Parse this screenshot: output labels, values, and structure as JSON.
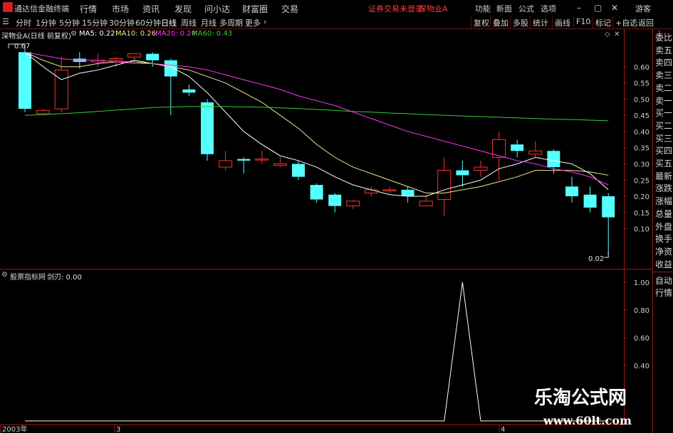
{
  "menubar": {
    "app_title": "通达信金融终端",
    "items": [
      "行情",
      "市场",
      "资讯",
      "发现",
      "问小达",
      "财富圈",
      "交易"
    ],
    "status_text": "证券交易未登录",
    "stock_name": "深物业A",
    "right_items": [
      "功能",
      "新面",
      "公式",
      "选项"
    ],
    "window_controls": [
      "–",
      "▢",
      "✕"
    ],
    "guest": "游客"
  },
  "toolbar": {
    "periods": [
      "分时",
      "1分钟",
      "5分钟",
      "15分钟",
      "30分钟",
      "60分钟",
      "日线",
      "周线",
      "月线",
      "多周期",
      "更多"
    ],
    "active_period": "日线",
    "right_buttons": [
      "复权",
      "叠加",
      "多股",
      "统计",
      "画线",
      "F10",
      "标记",
      "+自选",
      "返回"
    ]
  },
  "main_chart": {
    "title": "深物业A(日线 前复权)",
    "indicators": [
      {
        "label": "MA5: 0.22",
        "color": "#ffffff"
      },
      {
        "label": "MA10: 0.26",
        "color": "#f0e68c"
      },
      {
        "label": "MA20: 0.24",
        "color": "#ff33ff"
      },
      {
        "label": "MA60: 0.43",
        "color": "#33cc33"
      }
    ],
    "high_marker": "0.67",
    "low_marker": "0.02",
    "corner_label": "L",
    "price_ticks": [
      "0.60",
      "0.55",
      "0.50",
      "0.45",
      "0.40",
      "0.35",
      "0.30",
      "0.25",
      "0.20",
      "0.15",
      "0.10"
    ]
  },
  "sub_chart": {
    "title": "股票指标网",
    "indicator": "剑刃: 0.00",
    "ticks": [
      "1.00",
      "0.80",
      "0.60",
      "0.40"
    ]
  },
  "date_axis": [
    "2003年",
    "3",
    "4"
  ],
  "side_panel": {
    "items": [
      "委比",
      "卖五",
      "卖四",
      "卖三",
      "卖二",
      "卖一",
      "买一",
      "买二",
      "买三",
      "买四",
      "买五",
      "最新",
      "涨跌",
      "涨幅",
      "总量",
      "外盘",
      "换手",
      "净资",
      "收益"
    ],
    "bottom_items": [
      "自动",
      "行情"
    ]
  },
  "watermark": {
    "title": "乐淘公式网",
    "url": "www.60lt.com"
  },
  "colors": {
    "up": "#ff3232",
    "down": "#54ffff",
    "grid": "#a01818",
    "ma5": "#ffffff",
    "ma10": "#f0e68c",
    "ma20": "#ff33ff",
    "ma60": "#33cc33"
  },
  "chart_data": [
    {
      "type": "candlestick",
      "title": "深物业A(日线 前复权)",
      "ylim": [
        0.02,
        0.67
      ],
      "candles": [
        {
          "o": 0.645,
          "h": 0.67,
          "l": 0.46,
          "c": 0.47
        },
        {
          "o": 0.455,
          "h": 0.47,
          "l": 0.45,
          "c": 0.465
        },
        {
          "o": 0.47,
          "h": 0.63,
          "l": 0.46,
          "c": 0.59
        },
        {
          "o": 0.625,
          "h": 0.645,
          "l": 0.595,
          "c": 0.615
        },
        {
          "o": 0.615,
          "h": 0.64,
          "l": 0.6,
          "c": 0.62
        },
        {
          "o": 0.62,
          "h": 0.63,
          "l": 0.6,
          "c": 0.625
        },
        {
          "o": 0.63,
          "h": 0.64,
          "l": 0.62,
          "c": 0.64
        },
        {
          "o": 0.64,
          "h": 0.645,
          "l": 0.6,
          "c": 0.62
        },
        {
          "o": 0.62,
          "h": 0.625,
          "l": 0.45,
          "c": 0.57
        },
        {
          "o": 0.53,
          "h": 0.545,
          "l": 0.51,
          "c": 0.52
        },
        {
          "o": 0.49,
          "h": 0.5,
          "l": 0.31,
          "c": 0.33
        },
        {
          "o": 0.29,
          "h": 0.34,
          "l": 0.28,
          "c": 0.31
        },
        {
          "o": 0.315,
          "h": 0.32,
          "l": 0.27,
          "c": 0.31
        },
        {
          "o": 0.315,
          "h": 0.34,
          "l": 0.3,
          "c": 0.315
        },
        {
          "o": 0.295,
          "h": 0.32,
          "l": 0.29,
          "c": 0.3
        },
        {
          "o": 0.3,
          "h": 0.31,
          "l": 0.25,
          "c": 0.26
        },
        {
          "o": 0.235,
          "h": 0.24,
          "l": 0.18,
          "c": 0.19
        },
        {
          "o": 0.205,
          "h": 0.21,
          "l": 0.15,
          "c": 0.17
        },
        {
          "o": 0.17,
          "h": 0.19,
          "l": 0.16,
          "c": 0.185
        },
        {
          "o": 0.21,
          "h": 0.23,
          "l": 0.2,
          "c": 0.22
        },
        {
          "o": 0.22,
          "h": 0.23,
          "l": 0.21,
          "c": 0.22
        },
        {
          "o": 0.22,
          "h": 0.23,
          "l": 0.18,
          "c": 0.2
        },
        {
          "o": 0.17,
          "h": 0.2,
          "l": 0.17,
          "c": 0.185
        },
        {
          "o": 0.19,
          "h": 0.32,
          "l": 0.14,
          "c": 0.28
        },
        {
          "o": 0.28,
          "h": 0.31,
          "l": 0.23,
          "c": 0.265
        },
        {
          "o": 0.28,
          "h": 0.31,
          "l": 0.26,
          "c": 0.29
        },
        {
          "o": 0.32,
          "h": 0.4,
          "l": 0.25,
          "c": 0.375
        },
        {
          "o": 0.36,
          "h": 0.375,
          "l": 0.32,
          "c": 0.34
        },
        {
          "o": 0.33,
          "h": 0.37,
          "l": 0.32,
          "c": 0.34
        },
        {
          "o": 0.34,
          "h": 0.345,
          "l": 0.27,
          "c": 0.29
        },
        {
          "o": 0.23,
          "h": 0.26,
          "l": 0.18,
          "c": 0.2
        },
        {
          "o": 0.205,
          "h": 0.23,
          "l": 0.15,
          "c": 0.165
        },
        {
          "o": 0.2,
          "h": 0.21,
          "l": 0.02,
          "c": 0.135
        }
      ],
      "ma5": [
        0.645,
        0.6,
        0.56,
        0.58,
        0.59,
        0.605,
        0.62,
        0.61,
        0.6,
        0.57,
        0.52,
        0.46,
        0.4,
        0.36,
        0.325,
        0.31,
        0.29,
        0.26,
        0.235,
        0.22,
        0.205,
        0.2,
        0.2,
        0.22,
        0.235,
        0.25,
        0.285,
        0.3,
        0.32,
        0.31,
        0.3,
        0.27,
        0.22
      ],
      "ma10": [
        0.645,
        0.62,
        0.6,
        0.6,
        0.61,
        0.615,
        0.615,
        0.61,
        0.6,
        0.59,
        0.57,
        0.55,
        0.52,
        0.49,
        0.45,
        0.41,
        0.36,
        0.32,
        0.29,
        0.27,
        0.25,
        0.23,
        0.21,
        0.21,
        0.22,
        0.23,
        0.245,
        0.26,
        0.28,
        0.28,
        0.28,
        0.275,
        0.265
      ],
      "ma20": [
        0.645,
        0.635,
        0.625,
        0.62,
        0.62,
        0.615,
        0.61,
        0.61,
        0.605,
        0.6,
        0.59,
        0.575,
        0.56,
        0.545,
        0.53,
        0.51,
        0.495,
        0.48,
        0.46,
        0.44,
        0.42,
        0.4,
        0.385,
        0.37,
        0.355,
        0.34,
        0.325,
        0.31,
        0.3,
        0.285,
        0.275,
        0.26,
        0.235
      ],
      "ma60": [
        0.45,
        0.452,
        0.455,
        0.458,
        0.462,
        0.466,
        0.47,
        0.474,
        0.476,
        0.477,
        0.477,
        0.477,
        0.476,
        0.475,
        0.473,
        0.471,
        0.468,
        0.465,
        0.462,
        0.46,
        0.457,
        0.455,
        0.452,
        0.45,
        0.448,
        0.446,
        0.444,
        0.442,
        0.44,
        0.438,
        0.437,
        0.435,
        0.433
      ]
    },
    {
      "type": "line",
      "title": "剑刃",
      "ylim": [
        0.0,
        1.0
      ],
      "series": [
        {
          "name": "剑刃",
          "values": [
            0,
            0,
            0,
            0,
            0,
            0,
            0,
            0,
            0,
            0,
            0,
            0,
            0,
            0,
            0,
            0,
            0,
            0,
            0,
            0,
            0,
            0,
            0,
            0,
            1,
            0,
            0,
            0,
            0,
            0,
            0,
            0,
            0
          ]
        }
      ]
    }
  ]
}
